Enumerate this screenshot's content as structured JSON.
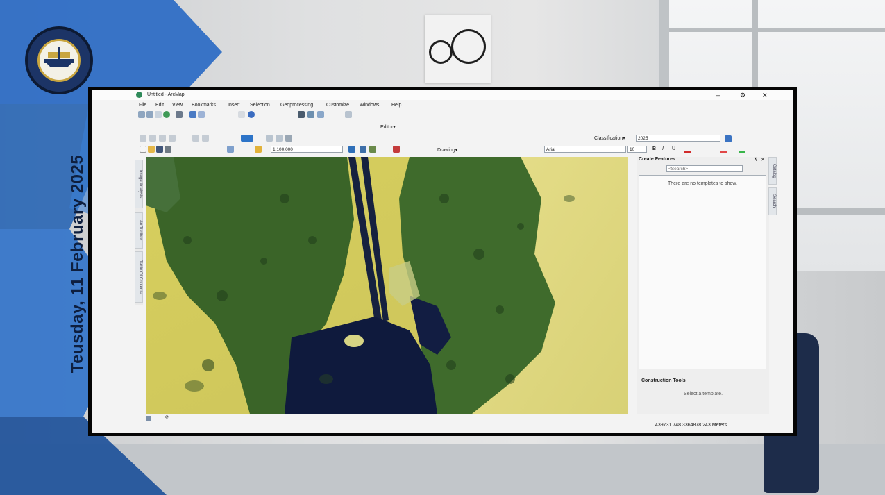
{
  "slide": {
    "date_text": "Teusday, 11 February 2025"
  },
  "app": {
    "window_title": "Untitled - ArcMap",
    "menu": [
      "File",
      "Edit",
      "View",
      "Bookmarks",
      "Insert",
      "Selection",
      "Geoprocessing",
      "Customize",
      "Windows",
      "Help"
    ],
    "editor_label": "Editor",
    "classification_label": "Classification",
    "layer_value": "2025",
    "scale_value": "1:100,000",
    "drawing_label": "Drawing",
    "font_name": "Arial",
    "font_size": "10",
    "bold": "B",
    "italic": "I",
    "underline": "U",
    "left_tabs": [
      "Image Analysis",
      "ArcToolbox",
      "Table Of Contents"
    ],
    "right_tabs": [
      "Catalog",
      "Search"
    ],
    "create_features": {
      "title": "Create Features",
      "search_placeholder": "<Search>",
      "empty_message": "There are no templates to show."
    },
    "construction_tools": {
      "title": "Construction Tools",
      "message": "Select a template."
    },
    "status_coords": "439731.748  3364878.243 Meters"
  },
  "colors": {
    "slide_blue": "#1f5fb3",
    "date_color": "#0e1f3f",
    "desert": "#d8cf66",
    "vegetation": "#3c6a2a",
    "water": "#0f1a3d"
  }
}
